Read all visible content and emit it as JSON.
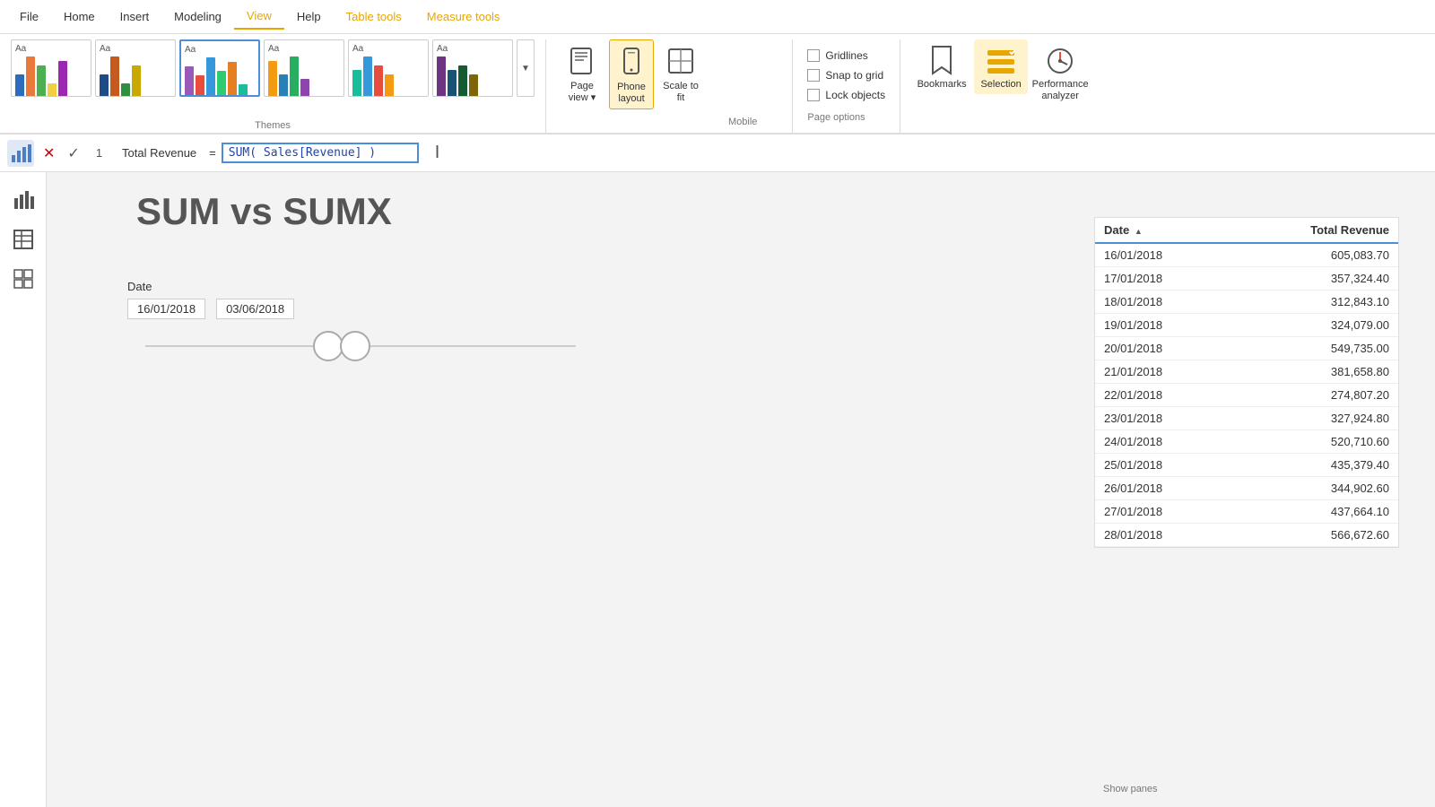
{
  "menubar": {
    "items": [
      "File",
      "Home",
      "Insert",
      "Modeling",
      "View",
      "Help",
      "Table tools",
      "Measure tools"
    ],
    "active": "View",
    "contextual": [
      "Table tools",
      "Measure tools"
    ]
  },
  "ribbon": {
    "themes_label": "Themes",
    "themes": [
      {
        "id": "t1",
        "colors": [
          "#2d6bbc",
          "#e8793a",
          "#4caf50",
          "#f0d040",
          "#9c27b0"
        ],
        "heights": [
          30,
          50,
          40,
          20,
          45
        ],
        "selected": false
      },
      {
        "id": "t2",
        "colors": [
          "#1e4a85",
          "#c45a1e",
          "#2e8f40",
          "#c9a800"
        ],
        "heights": [
          35,
          55,
          25,
          45
        ],
        "selected": false
      },
      {
        "id": "t3",
        "colors": [
          "#9b59b6",
          "#e74c3c",
          "#3498db",
          "#2ecc71",
          "#e67e22",
          "#1abc9c"
        ],
        "heights": [
          40,
          30,
          50,
          35,
          45,
          20
        ],
        "selected": true
      },
      {
        "id": "t4",
        "colors": [
          "#f39c12",
          "#2980b9",
          "#27ae60",
          "#8e44ad"
        ],
        "heights": [
          45,
          30,
          50,
          25
        ],
        "selected": false
      },
      {
        "id": "t5",
        "colors": [
          "#1abc9c",
          "#3498db",
          "#e74c3c",
          "#f39c12"
        ],
        "heights": [
          35,
          50,
          40,
          30
        ],
        "selected": false
      },
      {
        "id": "t6",
        "colors": [
          "#6c3483",
          "#1a5276",
          "#145a32",
          "#7d6608"
        ],
        "heights": [
          50,
          35,
          40,
          30
        ],
        "selected": false
      }
    ],
    "page_view": {
      "label": "Page view",
      "sublabel": "▾"
    },
    "phone_layout": {
      "label": "Phone layout",
      "sublabel": "Mobile"
    },
    "scale_to_fit": {
      "label": "Scale to fit"
    },
    "checkboxes": {
      "gridlines": {
        "label": "Gridlines",
        "checked": false
      },
      "snap_to_grid": {
        "label": "Snap to grid",
        "checked": false
      },
      "lock_objects": {
        "label": "Lock objects",
        "checked": false
      }
    },
    "page_options": {
      "label": "Page options"
    },
    "show_panes_label": "Show panes",
    "panes": {
      "bookmarks": "Bookmarks",
      "selection": "Selection",
      "performance_analyzer": "Performance analyzer"
    }
  },
  "formula_bar": {
    "measure_num": "1",
    "measure_name": "Total Revenue",
    "formula_text": "SUM( Sales[Revenue] )"
  },
  "canvas": {
    "title": "SUM vs SUMX",
    "slicer": {
      "label": "Date",
      "date_from": "16/01/2018",
      "date_to": "03/06/2018"
    },
    "table": {
      "col_date": "Date",
      "col_revenue": "Total Revenue",
      "rows": [
        {
          "date": "16/01/2018",
          "revenue": "605,083.70"
        },
        {
          "date": "17/01/2018",
          "revenue": "357,324.40"
        },
        {
          "date": "18/01/2018",
          "revenue": "312,843.10"
        },
        {
          "date": "19/01/2018",
          "revenue": "324,079.00"
        },
        {
          "date": "20/01/2018",
          "revenue": "549,735.00"
        },
        {
          "date": "21/01/2018",
          "revenue": "381,658.80"
        },
        {
          "date": "22/01/2018",
          "revenue": "274,807.20"
        },
        {
          "date": "23/01/2018",
          "revenue": "327,924.80"
        },
        {
          "date": "24/01/2018",
          "revenue": "520,710.60"
        },
        {
          "date": "25/01/2018",
          "revenue": "435,379.40"
        },
        {
          "date": "26/01/2018",
          "revenue": "344,902.60"
        },
        {
          "date": "27/01/2018",
          "revenue": "437,664.10"
        },
        {
          "date": "28/01/2018",
          "revenue": "566,672.60"
        }
      ]
    }
  }
}
